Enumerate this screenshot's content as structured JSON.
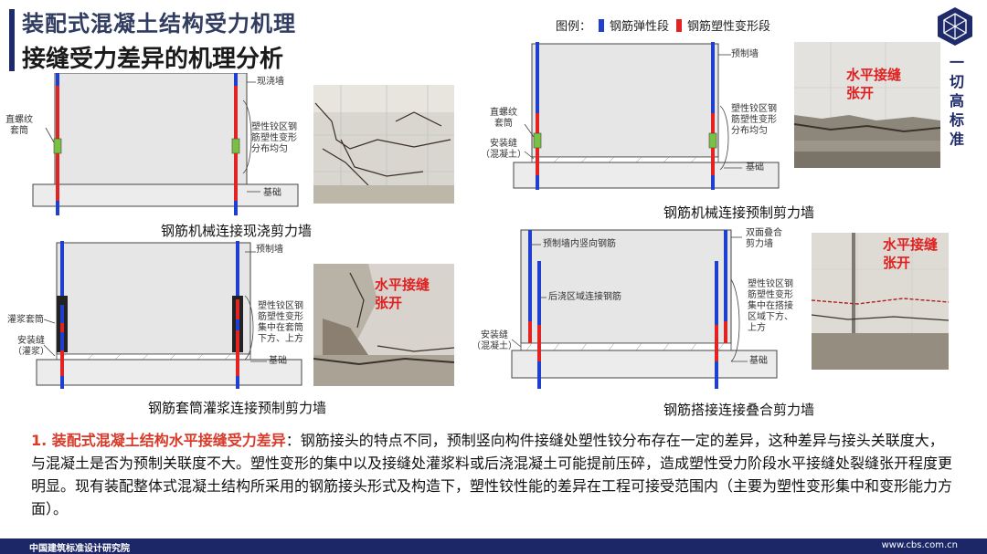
{
  "header": {
    "title": "装配式混凝土结构受力机理",
    "subtitle": "接缝受力差异的机理分析"
  },
  "side_tag": "一切高标准",
  "legend": {
    "prefix": "图例：",
    "elastic": "钢筋弹性段",
    "plastic": "钢筋塑性变形段",
    "elastic_color": "#1e3fd0",
    "plastic_color": "#e02424"
  },
  "diagrams": {
    "d1": {
      "caption": "钢筋机械连接现浇剪力墙",
      "labels": {
        "wall": "现浇墙",
        "coupler": "直螺纹\n套筒",
        "plastic": "塑性铰区钢\n筋塑性变形\n分布均匀",
        "base": "基础"
      }
    },
    "d2": {
      "caption": "钢筋机械连接预制剪力墙",
      "labels": {
        "wall": "预制墙",
        "coupler": "直螺纹\n套筒",
        "joint": "安装缝\n（混凝土）",
        "plastic": "塑性铰区钢\n筋塑性变形\n分布均匀",
        "base": "基础"
      }
    },
    "d3": {
      "caption": "钢筋套筒灌浆连接预制剪力墙",
      "labels": {
        "wall": "预制墙",
        "sleeve": "灌浆套筒",
        "joint": "安装缝\n（灌浆）",
        "plastic": "塑性铰区钢\n筋塑性变形\n集中在套筒\n下方、上方",
        "base": "基础"
      }
    },
    "d4": {
      "caption": "钢筋搭接连接叠合剪力墙",
      "labels": {
        "wall": "双面叠合\n剪力墙",
        "inner": "预制墙内竖向钢筋",
        "cast": "后浇区域连接钢筋",
        "joint": "安装缝\n（混凝土）",
        "plastic": "塑性铰区钢\n筋塑性变形\n集中在搭接\n区域下方、\n上方",
        "base": "基础"
      }
    }
  },
  "photos": {
    "p2": "水平接缝\n张开",
    "p3": "水平接缝\n张开",
    "p4": "水平接缝\n张开"
  },
  "body": {
    "highlight": "1. 装配式混凝土结构水平接缝受力差异",
    "text": "：钢筋接头的特点不同，预制竖向构件接缝处塑性铰分布存在一定的差异，这种差异与接头关联度大，与混凝土是否为预制关联度不大。塑性变形的集中以及接缝处灌浆料或后浇混凝土可能提前压碎，造成塑性受力阶段水平接缝处裂缝张开程度更明显。现有装配整体式混凝土结构所采用的钢筋接头形式及构造下，塑性铰性能的差异在工程可接受范围内（主要为塑性变形集中和变形能力方面）。"
  },
  "footer": {
    "left": "中国建筑标准设计研究院",
    "right": "www.cbs.com.cn"
  }
}
